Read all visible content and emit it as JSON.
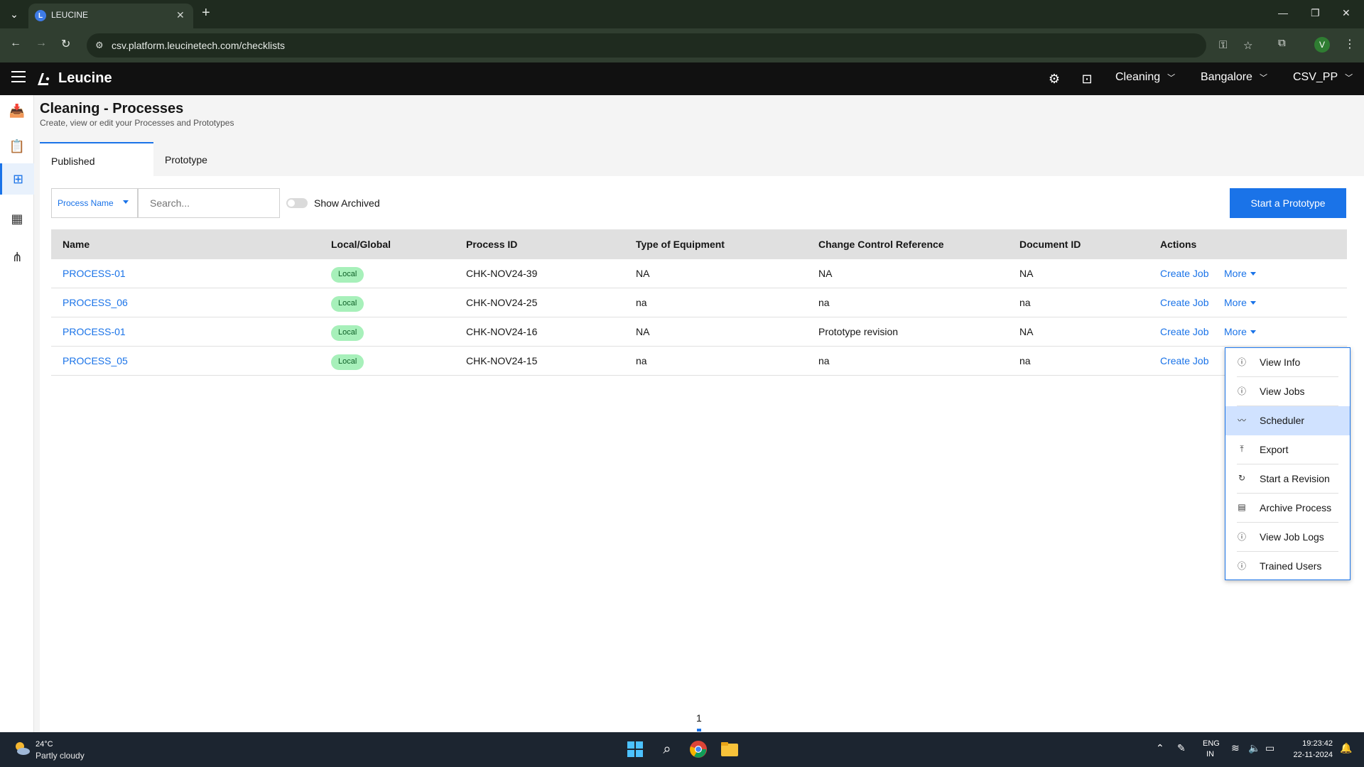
{
  "browser": {
    "tab_title": "LEUCINE",
    "url": "csv.platform.leucinetech.com/checklists",
    "profile_initial": "V"
  },
  "app": {
    "logo_text": "Leucine",
    "header": {
      "facility_select": "Cleaning",
      "location_select": "Bangalore",
      "user_select": "CSV_PP"
    }
  },
  "page": {
    "title": "Cleaning - Processes",
    "subtitle": "Create, view or edit your Processes and Prototypes",
    "tabs": [
      {
        "label": "Published",
        "active": true
      },
      {
        "label": "Prototype",
        "active": false
      }
    ]
  },
  "filters": {
    "field_select": "Process Name",
    "search_placeholder": "Search...",
    "show_archived_label": "Show Archived",
    "show_archived": false,
    "primary_action": "Start a Prototype"
  },
  "table": {
    "headers": [
      "Name",
      "Local/Global",
      "Process ID",
      "Type of Equipment",
      "Change Control Reference",
      "Document ID",
      "Actions"
    ],
    "rows": [
      {
        "name": "PROCESS-01",
        "scope": "Local",
        "process_id": "CHK-NOV24-39",
        "equipment": "NA",
        "change_control": "NA",
        "document_id": "NA",
        "action": "Create Job",
        "more": "More"
      },
      {
        "name": "PROCESS_06",
        "scope": "Local",
        "process_id": "CHK-NOV24-25",
        "equipment": "na",
        "change_control": "na",
        "document_id": "na",
        "action": "Create Job",
        "more": "More"
      },
      {
        "name": "PROCESS-01",
        "scope": "Local",
        "process_id": "CHK-NOV24-16",
        "equipment": "NA",
        "change_control": "Prototype revision",
        "document_id": "NA",
        "action": "Create Job",
        "more": "More"
      },
      {
        "name": "PROCESS_05",
        "scope": "Local",
        "process_id": "CHK-NOV24-15",
        "equipment": "na",
        "change_control": "na",
        "document_id": "na",
        "action": "Create Job",
        "more": ""
      }
    ]
  },
  "more_menu": {
    "items": [
      {
        "label": "View Info",
        "icon": "info-doc-icon"
      },
      {
        "label": "View Jobs",
        "icon": "info-doc-icon"
      },
      {
        "label": "Scheduler",
        "icon": "trend-icon",
        "highlighted": true
      },
      {
        "label": "Export",
        "icon": "export-icon"
      },
      {
        "label": "Start a Revision",
        "icon": "refresh-icon"
      },
      {
        "label": "Archive Process",
        "icon": "archive-icon"
      },
      {
        "label": "View Job Logs",
        "icon": "info-doc-icon"
      },
      {
        "label": "Trained Users",
        "icon": "info-doc-icon"
      }
    ]
  },
  "pagination": {
    "current_page": "1"
  },
  "taskbar": {
    "weather_temp": "24°C",
    "weather_desc": "Partly cloudy",
    "lang_line1": "ENG",
    "lang_line2": "IN",
    "time": "19:23:42",
    "date": "22-11-2024"
  },
  "colors": {
    "accent": "#1a73e8",
    "badge_bg": "#a7f0ba",
    "appbar": "#111111"
  }
}
